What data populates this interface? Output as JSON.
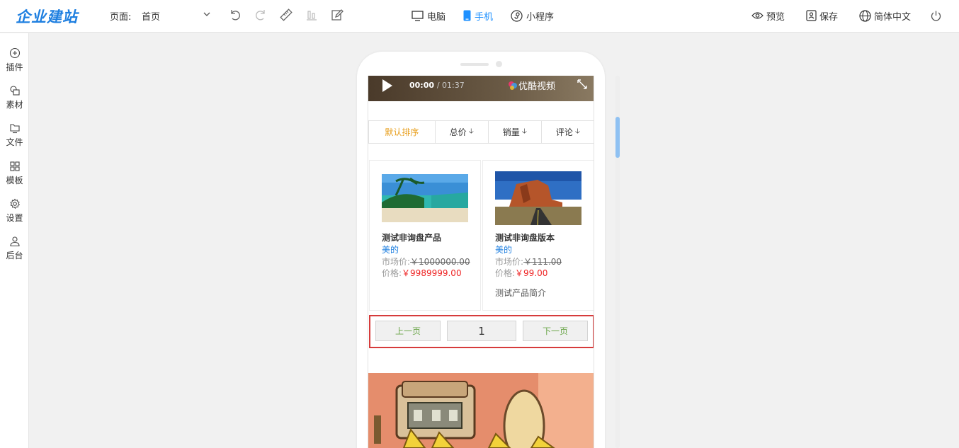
{
  "header": {
    "logo": "企业建站",
    "page_label": "页面:",
    "page_value": "首页",
    "devices": [
      {
        "label": "电脑",
        "icon": "monitor-icon",
        "active": false
      },
      {
        "label": "手机",
        "icon": "mobile-icon",
        "active": true
      },
      {
        "label": "小程序",
        "icon": "miniprogram-icon",
        "active": false
      }
    ],
    "right_tools": [
      {
        "label": "预览",
        "icon": "eye-icon"
      },
      {
        "label": "保存",
        "icon": "save-icon"
      },
      {
        "label": "简体中文",
        "icon": "globe-icon"
      }
    ]
  },
  "sidebar": {
    "items": [
      {
        "label": "插件",
        "icon": "plus-circle-icon"
      },
      {
        "label": "素材",
        "icon": "material-icon"
      },
      {
        "label": "文件",
        "icon": "folder-icon"
      },
      {
        "label": "模板",
        "icon": "grid-icon"
      },
      {
        "label": "设置",
        "icon": "gear-icon"
      },
      {
        "label": "后台",
        "icon": "user-icon"
      }
    ]
  },
  "video": {
    "current": "00:00",
    "duration": "/ 01:37",
    "brand": "优酷视频"
  },
  "sort": {
    "items": [
      "默认排序",
      "总价",
      "销量",
      "评论"
    ]
  },
  "products": [
    {
      "name": "测试非询盘产品",
      "brand": "美的",
      "market_label": "市场价:",
      "market_price": "￥1000000.00",
      "price_label": "价格:",
      "price": "￥9989999.00",
      "desc": ""
    },
    {
      "name": "测试非询盘版本",
      "brand": "美的",
      "market_label": "市场价:",
      "market_price": "￥111.00",
      "price_label": "价格:",
      "price": "￥99.00",
      "desc": "测试产品简介"
    }
  ],
  "pager": {
    "prev": "上一页",
    "page": "1",
    "next": "下一页"
  },
  "colors": {
    "accent": "#1e90ff",
    "sort_active": "#e8a020",
    "price": "#ee2222",
    "highlight_border": "#d63b3b",
    "pager_text": "#6aa548"
  }
}
